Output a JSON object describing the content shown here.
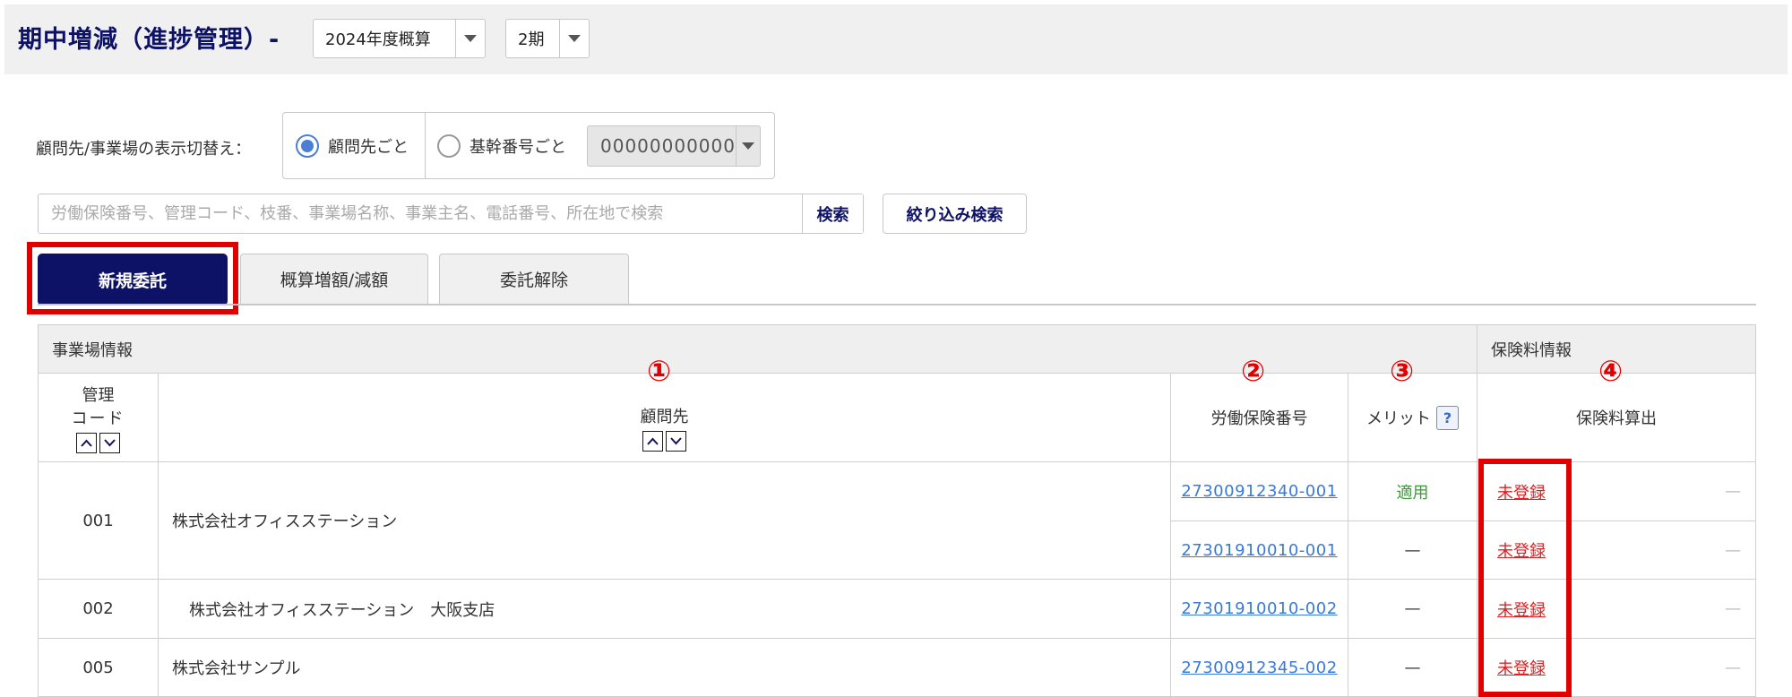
{
  "header": {
    "title": "期中増減（進捗管理）-",
    "year_select": "2024年度概算",
    "period_select": "2期"
  },
  "display_switch": {
    "label": "顧問先/事業場の表示切替え：",
    "option_client": "顧問先ごと",
    "option_base": "基幹番号ごと",
    "base_number": "00000000000"
  },
  "search": {
    "placeholder": "労働保険番号、管理コード、枝番、事業場名称、事業主名、電話番号、所在地で検索",
    "button": "検索",
    "filter_button": "絞り込み検索"
  },
  "tabs": {
    "new": "新規委託",
    "gaisan": "概算増額/減額",
    "kaijo": "委託解除"
  },
  "table": {
    "group_office": "事業場情報",
    "group_insurance": "保険料情報",
    "col_code_line1": "管理",
    "col_code_line2": "コード",
    "col_client": "顧問先",
    "col_insurance_no": "労働保険番号",
    "col_merit": "メリット",
    "col_calc": "保険料算出",
    "help_mark": "?",
    "marks": [
      "①",
      "②",
      "③",
      "④"
    ],
    "rows": [
      {
        "code": "001",
        "client": "株式会社オフィスステーション",
        "entries": [
          {
            "insurance_no": "27300912340-001",
            "merit": "適用",
            "calc": "未登録",
            "extra": "—"
          },
          {
            "insurance_no": "27301910010-001",
            "merit": "—",
            "calc": "未登録",
            "extra": "—"
          }
        ]
      },
      {
        "code": "002",
        "client": "株式会社オフィスステーション　大阪支店",
        "entries": [
          {
            "insurance_no": "27301910010-002",
            "merit": "—",
            "calc": "未登録",
            "extra": "—"
          }
        ]
      },
      {
        "code": "005",
        "client": "株式会社サンプル",
        "entries": [
          {
            "insurance_no": "27300912345-002",
            "merit": "—",
            "calc": "未登録",
            "extra": "—"
          }
        ]
      }
    ]
  }
}
